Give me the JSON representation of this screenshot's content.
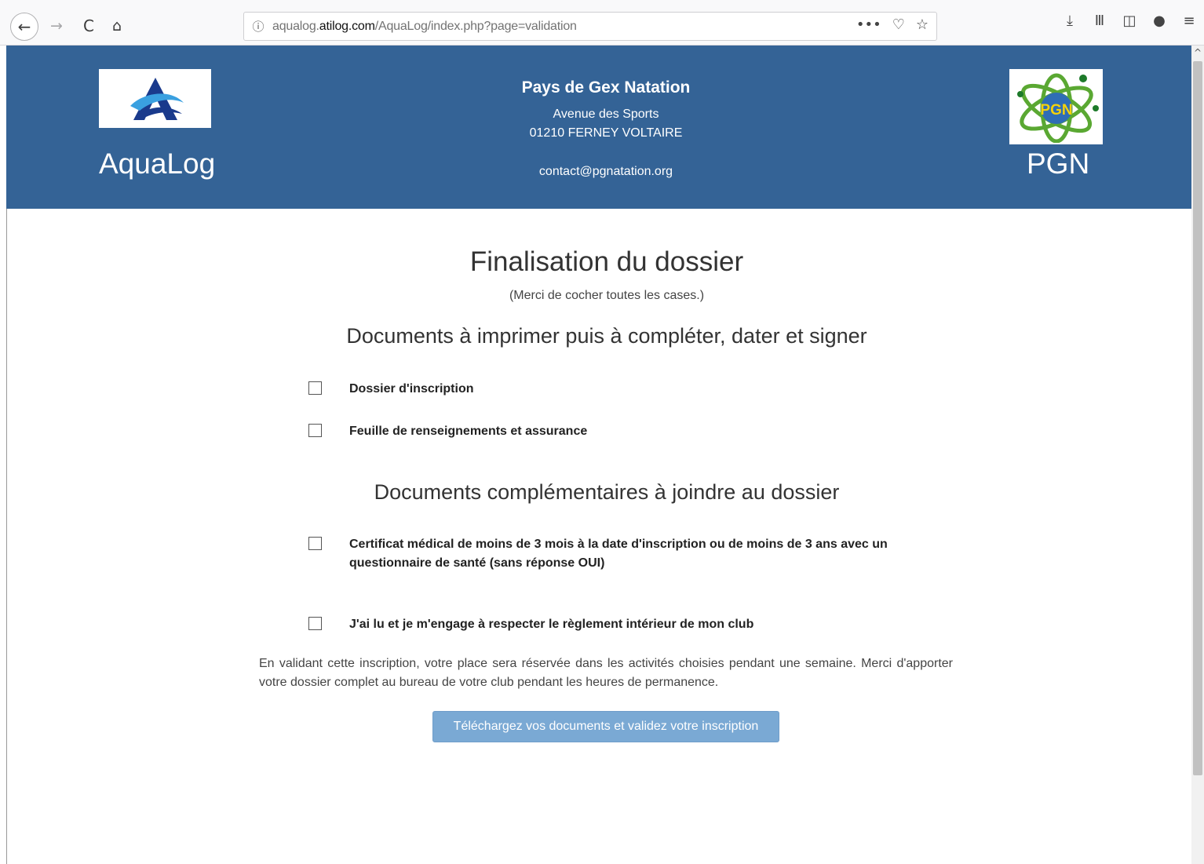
{
  "browser": {
    "url_prefix": "aqualog.",
    "url_domain": "atilog.com",
    "url_path": "/AquaLog/index.php?page=validation",
    "back_icon": "←",
    "forward_icon": "→",
    "reload_icon": "C",
    "home_icon": "⌂",
    "info_icon": "ⓘ",
    "more_icon": "•••",
    "pocket_icon": "♡",
    "bookmark_icon": "☆",
    "download_icon": "⤓",
    "library_icon": "Ⅲ",
    "sidebar_icon": "◫",
    "account_icon": "●",
    "menu_icon": "≡"
  },
  "header": {
    "brand_left": "AquaLog",
    "brand_right": "PGN",
    "logo_right_text": "PGN",
    "club_name": "Pays de Gex Natation",
    "address_line1": "Avenue des Sports",
    "address_line2": "01210 FERNEY VOLTAIRE",
    "email": "contact@pgnatation.org",
    "bg_color": "#346396"
  },
  "main": {
    "title": "Finalisation du dossier",
    "subtitle": "(Merci de cocher toutes les cases.)",
    "section1_title": "Documents à imprimer puis à compléter, dater et signer",
    "section1_items": [
      "Dossier d'inscription",
      "Feuille de renseignements et assurance"
    ],
    "section2_title": "Documents complémentaires à joindre au dossier",
    "section2_items": [
      "Certificat médical de moins de 3 mois à la date d'inscription ou de moins de 3 ans avec un questionnaire de santé (sans réponse OUI)"
    ],
    "rules_item": "J'ai lu et je m'engage à respecter le règlement intérieur de mon club",
    "info_text": "En validant cette inscription, votre place sera réservée dans les activités choisies pendant une semaine. Merci d'apporter votre dossier complet au bureau de votre club pendant les heures de permanence.",
    "submit_label": "Téléchargez vos documents et validez votre inscription",
    "button_color": "#7aa9d4"
  },
  "scrollbar": {
    "up_icon": "^"
  }
}
